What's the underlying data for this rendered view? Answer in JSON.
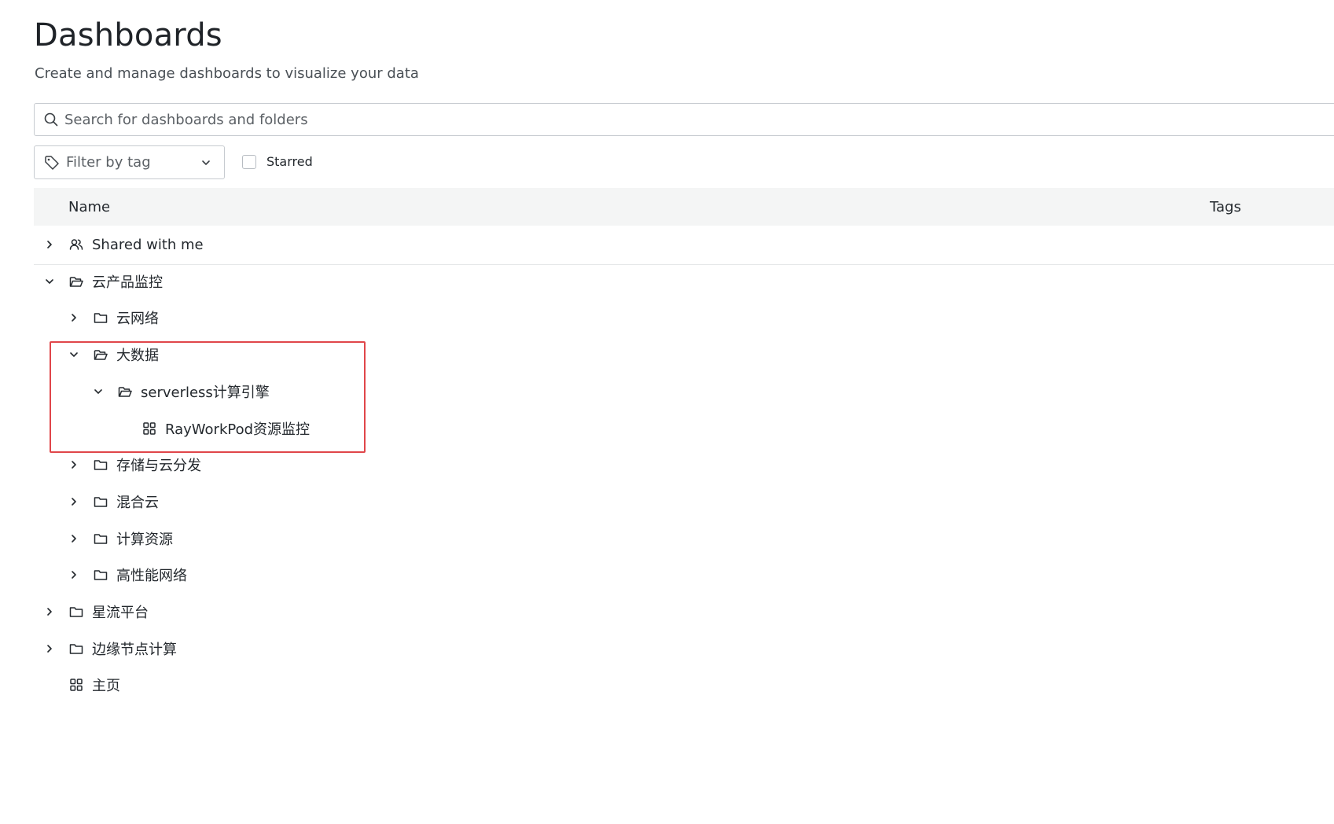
{
  "page": {
    "title": "Dashboards",
    "subtitle": "Create and manage dashboards to visualize your data"
  },
  "search": {
    "placeholder": "Search for dashboards and folders",
    "icon": "search-icon"
  },
  "filter": {
    "placeholder": "Filter by tag",
    "icon": "tag-icon"
  },
  "starred": {
    "label": "Starred",
    "checked": false
  },
  "table": {
    "columns": [
      "Name",
      "Tags"
    ]
  },
  "tree": [
    {
      "label": "Shared with me",
      "type": "shared",
      "expanded": false,
      "depth": 0
    },
    {
      "label": "云产品监控",
      "type": "folder",
      "expanded": true,
      "depth": 0
    },
    {
      "label": "云网络",
      "type": "folder",
      "expanded": false,
      "depth": 1
    },
    {
      "label": "大数据",
      "type": "folder",
      "expanded": true,
      "depth": 1
    },
    {
      "label": "serverless计算引擎",
      "type": "folder",
      "expanded": true,
      "depth": 2
    },
    {
      "label": "RayWorkPod资源监控",
      "type": "dashboard",
      "depth": 3
    },
    {
      "label": "存储与云分发",
      "type": "folder",
      "expanded": false,
      "depth": 1
    },
    {
      "label": "混合云",
      "type": "folder",
      "expanded": false,
      "depth": 1
    },
    {
      "label": "计算资源",
      "type": "folder",
      "expanded": false,
      "depth": 1
    },
    {
      "label": "高性能网络",
      "type": "folder",
      "expanded": false,
      "depth": 1
    },
    {
      "label": "星流平台",
      "type": "folder",
      "expanded": false,
      "depth": 0
    },
    {
      "label": "边缘节点计算",
      "type": "folder",
      "expanded": false,
      "depth": 0
    },
    {
      "label": "主页",
      "type": "dashboard",
      "depth": 0
    }
  ],
  "colors": {
    "highlight": "#e0464a",
    "header_bg": "#f4f5f5"
  }
}
